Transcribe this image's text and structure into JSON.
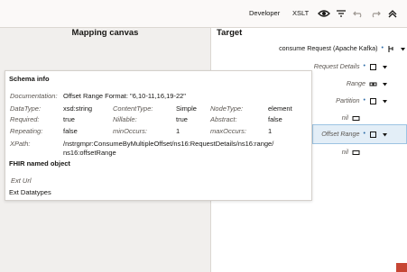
{
  "toolbar": {
    "developer_label": "Developer",
    "xslt_label": "XSLT",
    "icons": [
      "eye-icon",
      "filter-icon",
      "undo-icon",
      "redo-icon",
      "collapse-up-icon"
    ]
  },
  "mapping_canvas": {
    "title": "Mapping canvas"
  },
  "target": {
    "title": "Target",
    "nodes": [
      {
        "label": "consume Request (Apache Kafka)"
      },
      {
        "label": "Request Details"
      },
      {
        "label": "Range"
      },
      {
        "label": "Partition"
      },
      {
        "label": "nil"
      },
      {
        "label": "Offset Range"
      },
      {
        "label": "nil"
      }
    ]
  },
  "schema_info": {
    "heading": "Schema info",
    "documentation_key": "Documentation:",
    "documentation_value": "Offset Range Format: \"6,10-11,16,19-22\"",
    "datatype_key": "DataType:",
    "datatype_value": "xsd:string",
    "contenttype_key": "ContentType:",
    "contenttype_value": "Simple",
    "nodetype_key": "NodeType:",
    "nodetype_value": "element",
    "required_key": "Required:",
    "required_value": "true",
    "nillable_key": "Nillable:",
    "nillable_value": "true",
    "abstract_key": "Abstract:",
    "abstract_value": "false",
    "repeating_key": "Repeating:",
    "repeating_value": "false",
    "minoccurs_key": "minOccurs:",
    "minoccurs_value": "1",
    "maxoccurs_key": "maxOccurs:",
    "maxoccurs_value": "1",
    "xpath_key": "XPath:",
    "xpath_line1": "/nstrgmpr:ConsumeByMultipleOffset/ns16:RequestDetails/ns16:range/",
    "xpath_line2": "ns16:offsetRange"
  },
  "fhir": {
    "heading": "FHIR named object",
    "ext_url_label": "Ext Url",
    "ext_datatypes_label": "Ext Datatypes"
  },
  "colors": {
    "accent": "#2b6aa6",
    "highlight": "#e3eef7",
    "brand_red": "#c74634"
  }
}
